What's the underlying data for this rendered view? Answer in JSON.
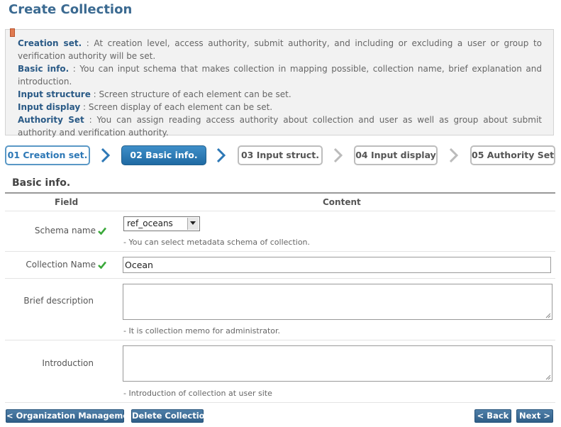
{
  "page": {
    "title": "Create Collection"
  },
  "info": {
    "items": [
      {
        "key": "Creation set.",
        "text": " : At creation level, access authority, submit authority, and including or excluding a user or group to verification authority will be set."
      },
      {
        "key": "Basic info.",
        "text": " : You can input schema that makes collection in mapping possible, collection name, brief explanation and introduction."
      },
      {
        "key": "Input structure",
        "text": " : Screen structure of each element can be set."
      },
      {
        "key": "Input display",
        "text": " : Screen display of each element can be set."
      },
      {
        "key": "Authority Set",
        "text": " : You can assign reading access authority about collection and user as well as group about submit authority and verification authority."
      }
    ]
  },
  "steps": [
    {
      "label": "01 Creation set.",
      "state": "done"
    },
    {
      "label": "02 Basic info.",
      "state": "active"
    },
    {
      "label": "03 Input struct.",
      "state": "todo"
    },
    {
      "label": "04 Input display",
      "state": "todo"
    },
    {
      "label": "05 Authority Set",
      "state": "todo"
    }
  ],
  "section": {
    "title": "Basic info."
  },
  "table": {
    "headers": {
      "field": "Field",
      "content": "Content"
    },
    "schema": {
      "label": "Schema name",
      "value": "ref_oceans",
      "hint": "- You can select metadata schema of collection."
    },
    "collection_name": {
      "label": "Collection Name",
      "value": "Ocean"
    },
    "brief": {
      "label": "Brief description",
      "hint": "- It is collection memo for administrator."
    },
    "intro": {
      "label": "Introduction",
      "hint": "- Introduction of collection at user site"
    }
  },
  "buttons": {
    "org": "< Organization Management",
    "delete": "Delete Collection",
    "back": "< Back",
    "next": "Next >"
  },
  "colors": {
    "accent": "#2d78b6",
    "title": "#3b6a91",
    "check": "#3aa83a"
  }
}
